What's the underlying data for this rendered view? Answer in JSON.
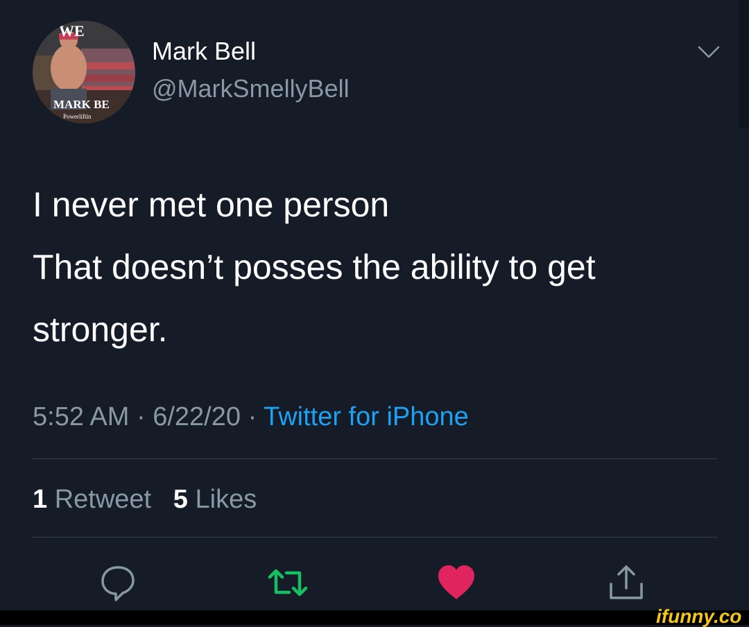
{
  "user": {
    "display_name": "Mark Bell",
    "handle": "@MarkSmellyBell",
    "avatar_text_top": "WE",
    "avatar_text_bottom": "MARK BE",
    "avatar_text_sub": "Powerliftin"
  },
  "tweet": {
    "lines": [
      "I never met one person",
      "That doesn’t posses the ability to get",
      "stronger."
    ],
    "time": "5:52 AM",
    "date": "6/22/20",
    "separator": "·",
    "source": "Twitter for iPhone"
  },
  "stats": {
    "retweet_count": "1",
    "retweet_label": "Retweet",
    "like_count": "5",
    "like_label": "Likes"
  },
  "actions": [
    "reply-icon",
    "retweet-icon",
    "like-icon",
    "share-icon"
  ],
  "colors": {
    "background": "#151c27",
    "muted": "#8899a6",
    "link": "#1da1f2",
    "retweet": "#17bf63",
    "like": "#e0245e",
    "watermark": "#f5c518"
  },
  "watermark": "ifunny.co"
}
